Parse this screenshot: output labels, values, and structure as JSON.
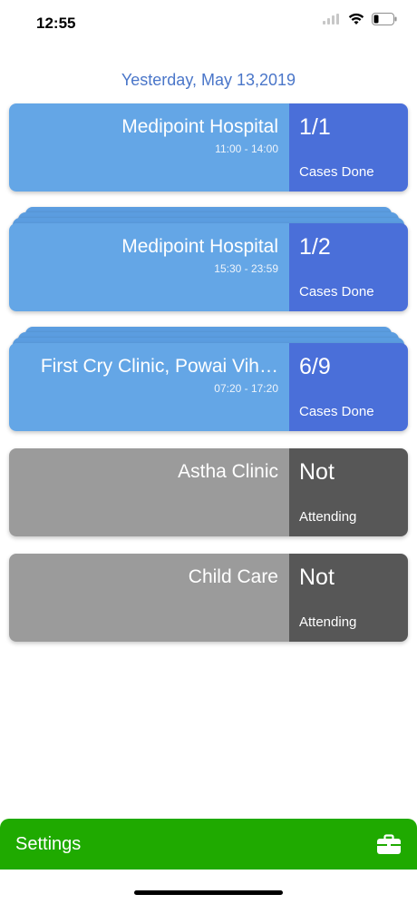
{
  "status_bar": {
    "time": "12:55",
    "battery_level": 0.25
  },
  "date_header": "Yesterday, May 13,2019",
  "cards": [
    {
      "name": "Medipoint Hospital",
      "time": "11:00 - 14:00",
      "count": "1/1",
      "count_label": "Cases Done",
      "state": "active",
      "stacked": false
    },
    {
      "name": "Medipoint Hospital",
      "time": "15:30 - 23:59",
      "count": "1/2",
      "count_label": "Cases Done",
      "state": "active",
      "stacked": true
    },
    {
      "name": "First Cry Clinic, Powai Vih…",
      "time": "07:20 - 17:20",
      "count": "6/9",
      "count_label": "Cases Done",
      "state": "active",
      "stacked": true
    },
    {
      "name": "Astha Clinic",
      "time": "",
      "count": "Not",
      "count_label": "Attending",
      "state": "inactive",
      "stacked": false
    },
    {
      "name": "Child Care",
      "time": "",
      "count": "Not",
      "count_label": "Attending",
      "state": "inactive",
      "stacked": false
    }
  ],
  "settings": {
    "label": "Settings",
    "icon": "briefcase-icon"
  },
  "colors": {
    "active_left": "#64a6e6",
    "active_right": "#4a6fd9",
    "inactive_left": "#9b9b9b",
    "inactive_right": "#575757",
    "settings_bar": "#1faa00",
    "date_text": "#4a76c9"
  }
}
